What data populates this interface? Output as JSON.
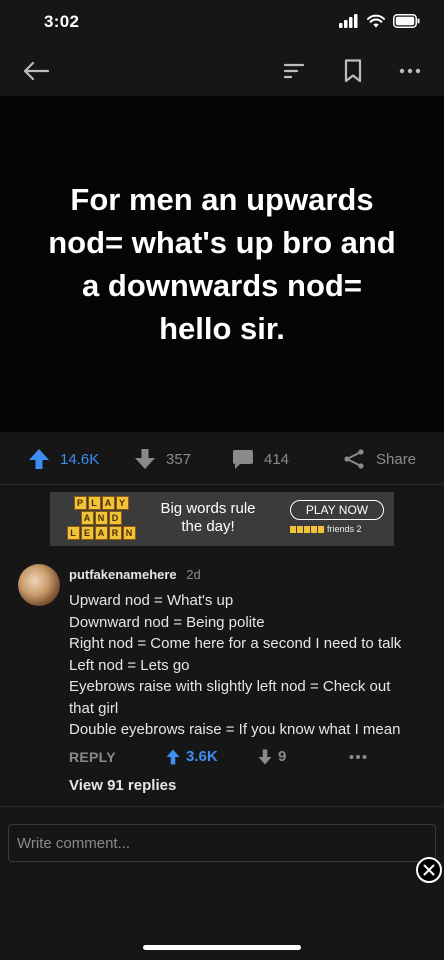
{
  "status_bar": {
    "time": "3:02",
    "icons": [
      "cellular-signal-icon",
      "wifi-icon",
      "battery-icon"
    ]
  },
  "app_bar": {
    "icons": [
      "back-arrow-icon",
      "sort-icon",
      "bookmark-icon",
      "more-icon"
    ]
  },
  "post": {
    "title_lines": [
      "For men an upwards",
      "nod= what's up bro and",
      "a downwards nod=",
      "hello sir."
    ],
    "upvotes": "14.6K",
    "downvotes": "357",
    "comments": "414",
    "share_label": "Share"
  },
  "ad": {
    "tiles": [
      [
        "P",
        "L",
        "A",
        "Y"
      ],
      [
        "A",
        "N",
        "D"
      ],
      [
        "L",
        "E",
        "A",
        "R",
        "N"
      ]
    ],
    "copy_line1": "Big words rule",
    "copy_line2": "the day!",
    "cta": "PLAY NOW",
    "logo_text": "friends 2",
    "logo_small": "with"
  },
  "comment": {
    "author": "putfakenamehere",
    "age": "2d",
    "lines": [
      "Upward nod = What's up",
      "Downward nod = Being polite",
      "Right nod = Come here for a second I need to talk",
      "Left nod = Lets go",
      "Eyebrows raise with slightly left nod = Check out",
      "that girl",
      "Double eyebrows raise = If you know what I mean"
    ],
    "reply_label": "REPLY",
    "upvotes": "3.6K",
    "downvotes": "9",
    "view_replies": "View 91 replies"
  },
  "composer": {
    "placeholder": "Write comment..."
  },
  "colors": {
    "accent": "#3d8ef0",
    "background": "#161616",
    "media_background": "#050505",
    "muted": "#8a8a8a"
  }
}
